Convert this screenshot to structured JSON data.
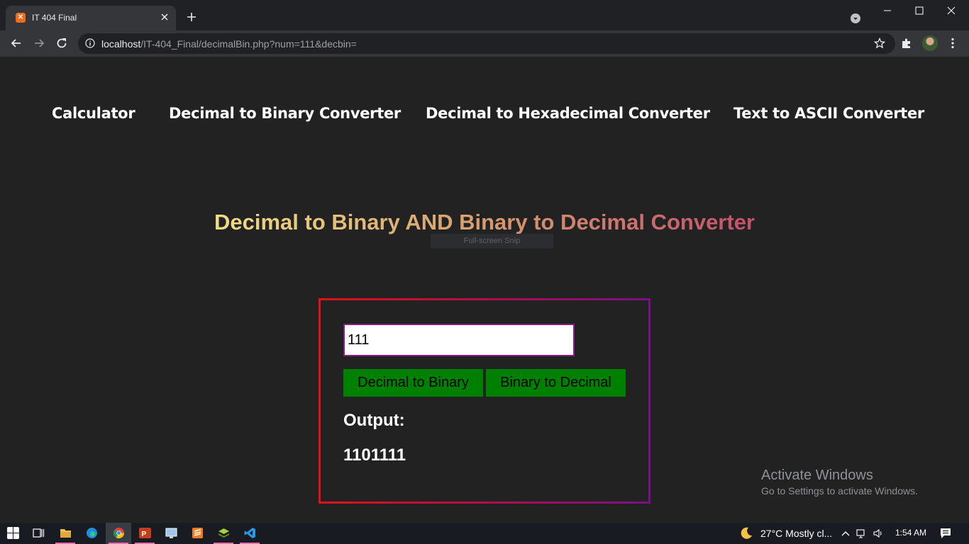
{
  "browser": {
    "tab_title": "IT 404 Final",
    "url_host": "localhost",
    "url_path": "/IT-404_Final/decimalBin.php?num=111&decbin="
  },
  "nav": {
    "items": [
      {
        "label": "Calculator"
      },
      {
        "label": "Decimal to Binary Converter"
      },
      {
        "label": "Decimal to Hexadecimal Converter"
      },
      {
        "label": "Text to ASCII Converter"
      }
    ]
  },
  "page": {
    "heading": "Decimal to Binary AND Binary to Decimal Converter",
    "snip_tooltip": "Full-screen Snip",
    "input_value": "111",
    "btn_dec_to_bin": "Decimal to Binary",
    "btn_bin_to_dec": "Binary to Decimal",
    "output_label": "Output:",
    "output_value": "1101111"
  },
  "watermark": {
    "title": "Activate Windows",
    "subtitle": "Go to Settings to activate Windows."
  },
  "taskbar": {
    "weather": "27°C  Mostly cl...",
    "time": "1:54 AM",
    "apps": [
      "start",
      "task-view",
      "file-explorer",
      "edge",
      "chrome",
      "powerpoint",
      "control-panel",
      "sublime-text",
      "layers",
      "vscode"
    ]
  },
  "colors": {
    "page_bg": "#222223",
    "button_green": "#008000",
    "border_start": "#e31017",
    "border_end": "#7a0f86"
  }
}
